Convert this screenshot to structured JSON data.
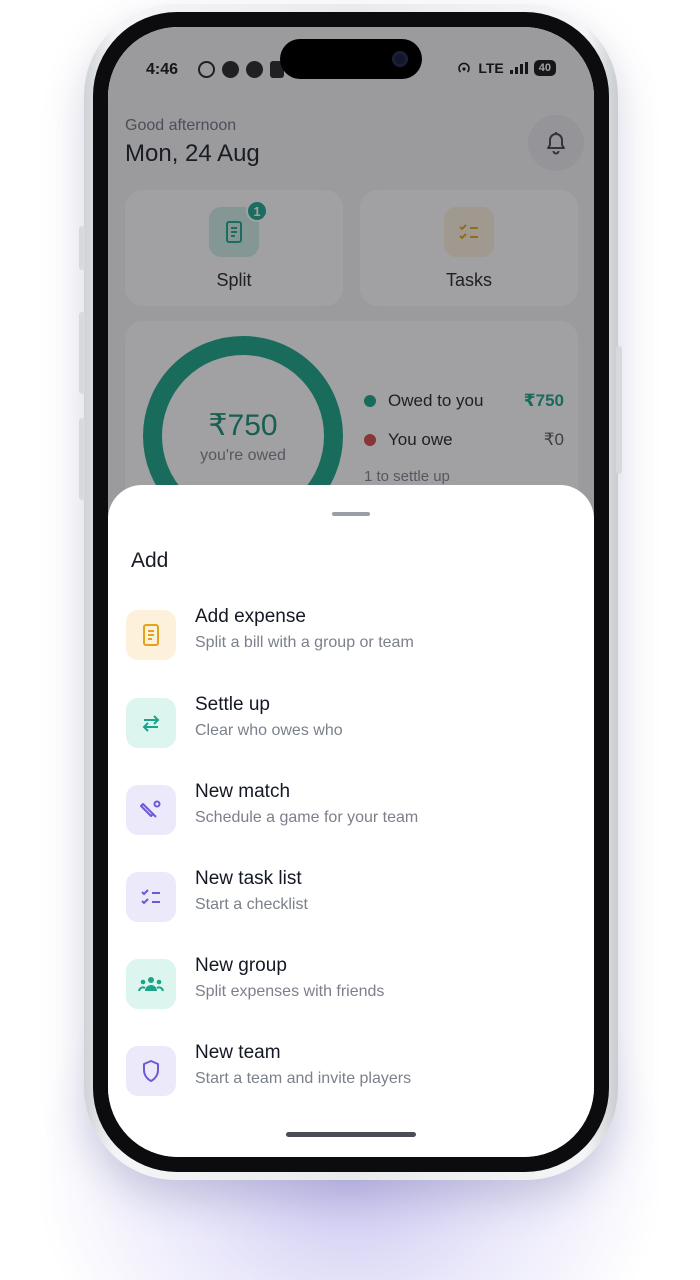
{
  "status_bar": {
    "time": "4:46",
    "network": "LTE",
    "battery": "40"
  },
  "header": {
    "greeting": "Good afternoon",
    "date": "Mon, 24 Aug",
    "bell_icon": "bell-icon"
  },
  "quick_tiles": [
    {
      "label": "Split",
      "icon": "receipt-icon",
      "badge": "1"
    },
    {
      "label": "Tasks",
      "icon": "checklist-icon"
    }
  ],
  "balance": {
    "amount": "₹750",
    "caption": "you're owed",
    "owed_to_you_label": "Owed to you",
    "owed_to_you_value": "₹750",
    "you_owe_label": "You owe",
    "you_owe_value": "₹0",
    "settle_note": "1 to settle up",
    "colors": {
      "owed": "#16a383",
      "owe": "#d64545"
    }
  },
  "sheet": {
    "title": "Add",
    "items": [
      {
        "title": "Add expense",
        "subtitle": "Split a bill with a group or team",
        "icon": "receipt-icon",
        "bg": "#fdf1dc",
        "fg": "#e3a21a"
      },
      {
        "title": "Settle up",
        "subtitle": "Clear who owes who",
        "icon": "swap-arrows-icon",
        "bg": "#dcf5ef",
        "fg": "#1aa58a"
      },
      {
        "title": "New match",
        "subtitle": "Schedule a game for your team",
        "icon": "cricket-bat-icon",
        "bg": "#ece9fb",
        "fg": "#6b5ad6"
      },
      {
        "title": "New task list",
        "subtitle": "Start a checklist",
        "icon": "checklist-icon",
        "bg": "#ece9fb",
        "fg": "#6b5ad6"
      },
      {
        "title": "New group",
        "subtitle": "Split expenses with friends",
        "icon": "group-icon",
        "bg": "#dcf5ef",
        "fg": "#1aa58a"
      },
      {
        "title": "New team",
        "subtitle": "Start a team and invite players",
        "icon": "shield-icon",
        "bg": "#ece9fb",
        "fg": "#6b5ad6"
      }
    ]
  }
}
